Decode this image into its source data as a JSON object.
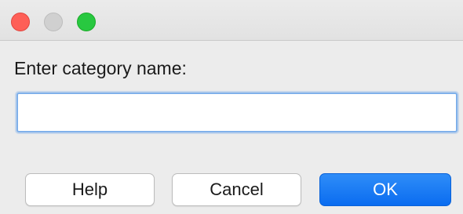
{
  "window": {
    "controls": {
      "close_color": "#fe5f57",
      "minimize_color": "#d0d0d0",
      "zoom_color": "#28c840"
    }
  },
  "dialog": {
    "prompt": "Enter category name:",
    "input": {
      "value": "",
      "placeholder": ""
    },
    "buttons": {
      "help_label": "Help",
      "cancel_label": "Cancel",
      "ok_label": "OK"
    },
    "accent_color": "#0a6cf0"
  }
}
